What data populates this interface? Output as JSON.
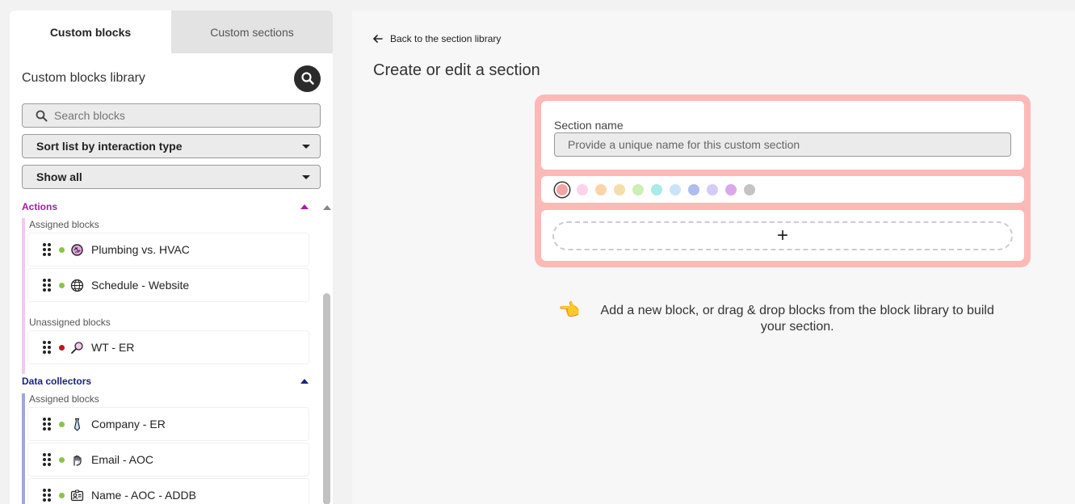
{
  "left_panel": {
    "tabs": [
      {
        "label": "Custom blocks",
        "active": true
      },
      {
        "label": "Custom sections",
        "active": false
      }
    ],
    "library_title": "Custom blocks library",
    "search": {
      "placeholder": "Search blocks",
      "value": ""
    },
    "sort_select": {
      "value": "Sort list by interaction type"
    },
    "filter_select": {
      "value": "Show all"
    },
    "categories": [
      {
        "name": "Actions",
        "color": "#a020a0",
        "bar_color": "#f4c7f4",
        "expanded": true,
        "assigned_label": "Assigned blocks",
        "unassigned_label": "Unassigned blocks",
        "assigned": [
          {
            "label": "Plumbing vs. HVAC",
            "status_color": "#8bc34a",
            "icon": "brain-icon"
          },
          {
            "label": "Schedule - Website",
            "status_color": "#8bc34a",
            "icon": "globe-icon"
          }
        ],
        "unassigned": [
          {
            "label": "WT - ER",
            "status_color": "#b71c1c",
            "icon": "magnifier-icon"
          }
        ]
      },
      {
        "name": "Data collectors",
        "color": "#1a237e",
        "bar_color": "#9fa8da",
        "expanded": true,
        "assigned_label": "Assigned blocks",
        "assigned": [
          {
            "label": "Company - ER",
            "status_color": "#8bc34a",
            "icon": "tie-icon"
          },
          {
            "label": "Email - AOC",
            "status_color": "#8bc34a",
            "icon": "hand-icon"
          },
          {
            "label": "Name - AOC - ADDB",
            "status_color": "#8bc34a",
            "icon": "id-card-icon"
          }
        ]
      }
    ]
  },
  "main": {
    "back_link": "Back to the section library",
    "title": "Create or edit a section",
    "section_form": {
      "card_color": "#fcb9b6",
      "name_label": "Section name",
      "name_placeholder": "Provide a unique name for this custom section",
      "name_value": "",
      "color_options": [
        "#f4a4a4",
        "#fbd3ea",
        "#fcd3a8",
        "#f5deab",
        "#cdeeb5",
        "#a9ebe6",
        "#c9e4fa",
        "#aebcf2",
        "#d4cbf8",
        "#d9a8ec",
        "#c4c4c4"
      ],
      "selected_color_index": 0,
      "add_button_label": "+"
    },
    "hint_emoji": "👈",
    "hint_text": "Add a new block, or drag & drop blocks from the block library to build your section."
  }
}
